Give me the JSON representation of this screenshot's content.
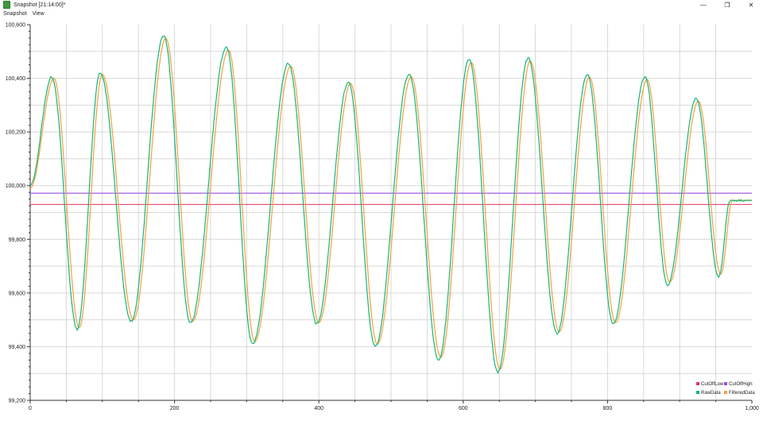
{
  "window": {
    "title": "Snapshot [21:14:00]*",
    "controls": {
      "minimize": "—",
      "maximize": "❐",
      "close": "✕"
    }
  },
  "menu": {
    "items": [
      "Snapshot",
      "View"
    ]
  },
  "colors": {
    "cutoff_low": "#e8305a",
    "cutoff_high": "#9a4de0",
    "raw": "#16b572",
    "filtered": "#f5a040",
    "grid": "#d8d8d8"
  },
  "chart_data": {
    "type": "line",
    "xlim": [
      0,
      1000
    ],
    "ylim": [
      99200,
      100600
    ],
    "x_ticks": [
      "0",
      "200",
      "400",
      "600",
      "800",
      "1,000"
    ],
    "x_tick_values": [
      0,
      200,
      400,
      600,
      800,
      1000
    ],
    "y_ticks": [
      "99,200",
      "99,400",
      "99,600",
      "99,800",
      "100,000",
      "100,200",
      "100,400",
      "100,600"
    ],
    "y_tick_values": [
      99200,
      99400,
      99600,
      99800,
      100000,
      100200,
      100400,
      100600
    ],
    "grid": true,
    "legend_position": "bottom-right",
    "series": [
      {
        "name": "CutOffLow",
        "type": "hline",
        "value": 99930
      },
      {
        "name": "CutOffHigh",
        "type": "hline",
        "value": 99972
      },
      {
        "name": "RawData",
        "peaks": [
          [
            0,
            100000
          ],
          [
            30,
            100405
          ],
          [
            65,
            99465
          ],
          [
            97,
            100420
          ],
          [
            140,
            99495
          ],
          [
            185,
            100560
          ],
          [
            222,
            99490
          ],
          [
            272,
            100515
          ],
          [
            308,
            99410
          ],
          [
            358,
            100455
          ],
          [
            397,
            99485
          ],
          [
            441,
            100385
          ],
          [
            478,
            99400
          ],
          [
            525,
            100415
          ],
          [
            566,
            99350
          ],
          [
            608,
            100470
          ],
          [
            648,
            99305
          ],
          [
            690,
            100475
          ],
          [
            730,
            99450
          ],
          [
            772,
            100415
          ],
          [
            808,
            99485
          ],
          [
            852,
            100405
          ],
          [
            883,
            99630
          ],
          [
            923,
            100325
          ],
          [
            954,
            99660
          ],
          [
            970,
            99945
          ],
          [
            1000,
            99945
          ]
        ]
      },
      {
        "name": "FilteredData",
        "peaks": [
          [
            0,
            99990
          ],
          [
            33,
            100400
          ],
          [
            68,
            99470
          ],
          [
            100,
            100415
          ],
          [
            143,
            99500
          ],
          [
            188,
            100550
          ],
          [
            225,
            99495
          ],
          [
            275,
            100505
          ],
          [
            311,
            99420
          ],
          [
            361,
            100445
          ],
          [
            400,
            99490
          ],
          [
            444,
            100380
          ],
          [
            481,
            99410
          ],
          [
            528,
            100405
          ],
          [
            569,
            99360
          ],
          [
            611,
            100460
          ],
          [
            651,
            99315
          ],
          [
            693,
            100465
          ],
          [
            733,
            99455
          ],
          [
            775,
            100405
          ],
          [
            811,
            99490
          ],
          [
            855,
            100395
          ],
          [
            886,
            99640
          ],
          [
            926,
            100315
          ],
          [
            957,
            99670
          ],
          [
            973,
            99945
          ],
          [
            1000,
            99945
          ]
        ]
      }
    ]
  }
}
